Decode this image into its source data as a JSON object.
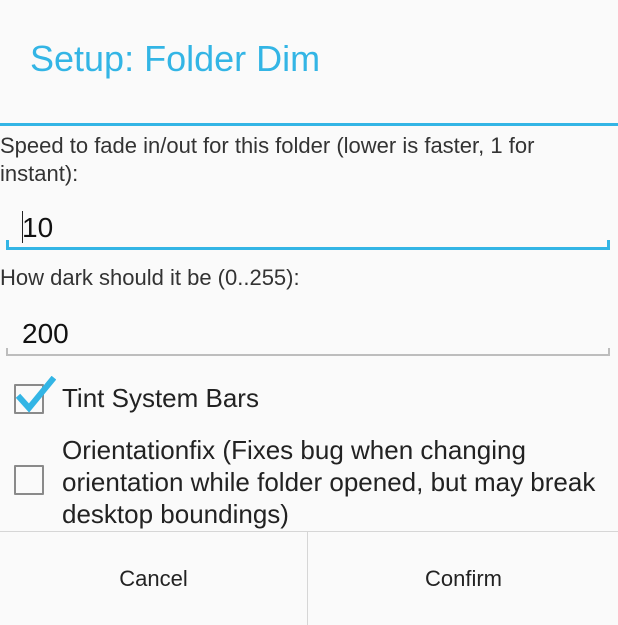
{
  "dialog": {
    "title": "Setup: Folder Dim",
    "accent_color": "#33b5e5"
  },
  "speed": {
    "label": "Speed to fade in/out for this folder (lower is faster, 1 for instant):",
    "value": "10"
  },
  "darkness": {
    "label": "How dark should it be (0..255):",
    "value": "200"
  },
  "options": {
    "tint_system_bars": {
      "label": "Tint System Bars",
      "checked": true
    },
    "orientation_fix": {
      "label": "Orientationfix (Fixes bug when changing orientation while folder opened, but may break desktop boundings)",
      "checked": false
    }
  },
  "buttons": {
    "cancel_label": "Cancel",
    "confirm_label": "Confirm"
  }
}
